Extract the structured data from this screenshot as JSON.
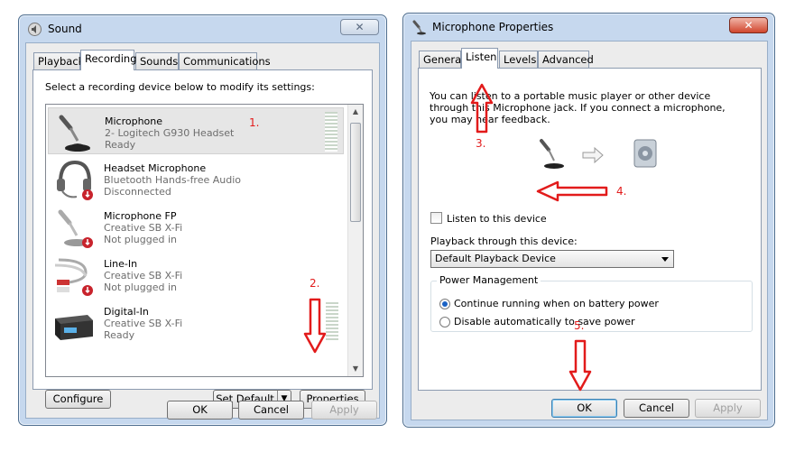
{
  "sound": {
    "title": "Sound",
    "tabs": [
      "Playback",
      "Recording",
      "Sounds",
      "Communications"
    ],
    "instruction": "Select a recording device below to modify its settings:",
    "devices": [
      {
        "name": "Microphone",
        "driver": "2- Logitech G930 Headset",
        "status": "Ready",
        "icon": "microphone-icon"
      },
      {
        "name": "Headset Microphone",
        "driver": "Bluetooth Hands-free Audio",
        "status": "Disconnected",
        "icon": "headset-icon"
      },
      {
        "name": "Microphone FP",
        "driver": "Creative SB X-Fi",
        "status": "Not plugged in",
        "icon": "microphone-icon"
      },
      {
        "name": "Line-In",
        "driver": "Creative SB X-Fi",
        "status": "Not plugged in",
        "icon": "rca-cable-icon"
      },
      {
        "name": "Digital-In",
        "driver": "Creative SB X-Fi",
        "status": "Ready",
        "icon": "digital-device-icon"
      }
    ],
    "buttons": {
      "configure": "Configure",
      "set_default": "Set Default",
      "properties": "Properties",
      "ok": "OK",
      "cancel": "Cancel",
      "apply": "Apply"
    }
  },
  "mic_props": {
    "title": "Microphone Properties",
    "tabs": [
      "General",
      "Listen",
      "Levels",
      "Advanced"
    ],
    "description": "You can listen to a portable music player or other device through this Microphone jack.  If you connect a microphone, you may hear feedback.",
    "listen_checkbox": "Listen to this device",
    "playback_label": "Playback through this device:",
    "playback_value": "Default Playback Device",
    "power_group": "Power Management",
    "power_options": [
      "Continue running when on battery power",
      "Disable automatically to save power"
    ],
    "buttons": {
      "ok": "OK",
      "cancel": "Cancel",
      "apply": "Apply"
    }
  },
  "annotations": [
    "1.",
    "2.",
    "3.",
    "4.",
    "5."
  ],
  "colors": {
    "annotation": "#e21b1b",
    "selection": "#e6e6e6",
    "window_frame": "#c6d8ee"
  }
}
